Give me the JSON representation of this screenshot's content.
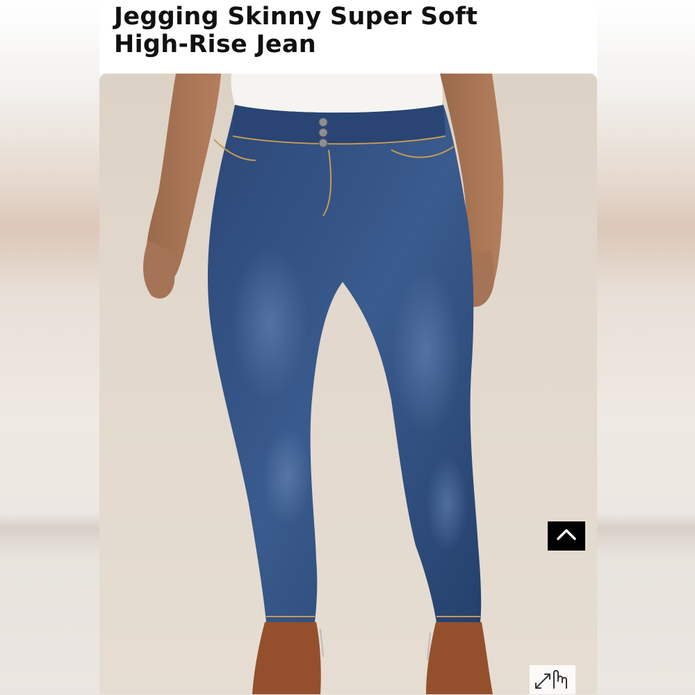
{
  "product": {
    "title": "Jegging Skinny Super Soft High-Rise Jean",
    "image_alt": "Model wearing dark wash high-rise skinny jeans with white top and brown ankle boots"
  },
  "controls": {
    "scroll_top_icon": "chevron-up-icon",
    "zoom_icon": "hand-expand-icon"
  },
  "colors": {
    "title_text": "#111111",
    "denim": "#2d4a78",
    "scroll_button_bg": "#000000"
  }
}
